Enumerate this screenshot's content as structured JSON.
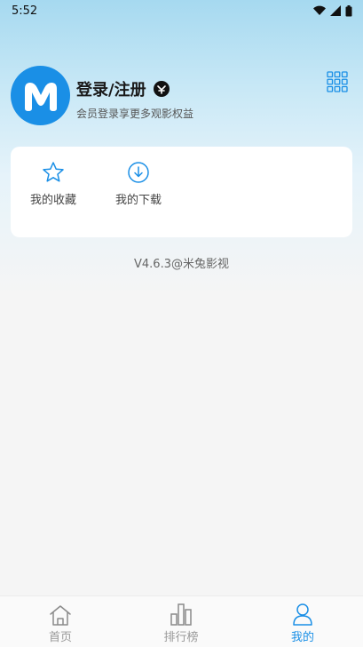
{
  "status_bar": {
    "time": "5:52"
  },
  "profile": {
    "title": "登录/注册",
    "subtitle": "会员登录享更多观影权益",
    "avatar_letter": "M"
  },
  "quick_actions": [
    {
      "label": "我的收藏",
      "icon": "star-icon"
    },
    {
      "label": "我的下载",
      "icon": "download-icon"
    }
  ],
  "version_text": "V4.6.3@米兔影视",
  "tabs": [
    {
      "label": "首页",
      "icon": "home-icon",
      "active": false
    },
    {
      "label": "排行榜",
      "icon": "ranking-icon",
      "active": false
    },
    {
      "label": "我的",
      "icon": "user-icon",
      "active": true
    }
  ],
  "colors": {
    "accent": "#1a8fe6",
    "background": "#f5f5f5",
    "tab_inactive": "#999999"
  }
}
